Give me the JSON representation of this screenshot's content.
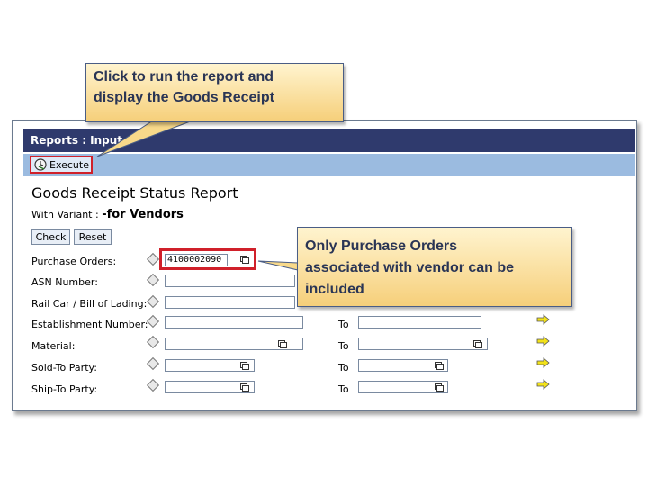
{
  "window": {
    "title": "Reports : Input S"
  },
  "toolbar": {
    "execute_label": "Execute"
  },
  "report": {
    "title": "Goods Receipt Status Report",
    "variant_prefix": "With Variant : ",
    "variant_name": "-for Vendors"
  },
  "buttons": {
    "check": "Check",
    "reset": "Reset"
  },
  "rows": [
    {
      "label": "Purchase Orders:",
      "value": "4100002090",
      "to": ""
    },
    {
      "label": "ASN Number:",
      "value": "",
      "to": ""
    },
    {
      "label": "Rail Car / Bill of Lading:",
      "value": "",
      "to": ""
    },
    {
      "label": "Establishment Number:",
      "value": "",
      "to": "To"
    },
    {
      "label": "Material:",
      "value": "",
      "to": "To"
    },
    {
      "label": "Sold-To Party:",
      "value": "",
      "to": "To"
    },
    {
      "label": "Ship-To Party:",
      "value": "",
      "to": "To"
    }
  ],
  "callouts": {
    "execute_line1": "Click to run the report and",
    "execute_line2": "display the Goods Receipt",
    "po_line1": "Only Purchase Orders",
    "po_line2": "associated with vendor can be",
    "po_line3": "included"
  },
  "icons": {
    "execute": "execute-clock-icon",
    "multiple_selection": "multiple-selection-icon",
    "arrow": "yellow-arrow-icon",
    "selection_option": "diamond-icon"
  },
  "colors": {
    "titlebar": "#2f3a6d",
    "toolbar": "#9bbbe0",
    "highlight": "#d0202a",
    "callout_top": "#fff4cf",
    "callout_bottom": "#f6cf7a"
  }
}
